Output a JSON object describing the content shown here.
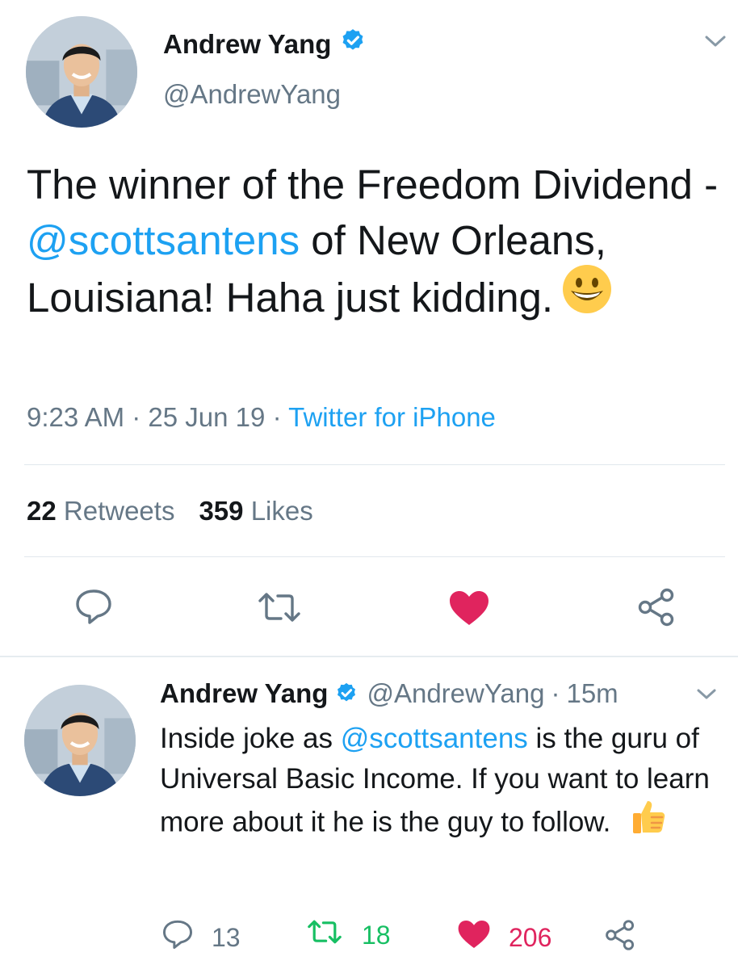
{
  "main_tweet": {
    "author_name": "Andrew Yang",
    "author_handle": "@AndrewYang",
    "text_before_mention": "The winner of the Freedom Dividend - ",
    "mention": "@scottsantens",
    "text_after_mention": " of New Orleans, Louisiana!  Haha just kidding.",
    "emoji": "grinning-face",
    "time": "9:23 AM",
    "date": "25 Jun 19",
    "source": "Twitter for iPhone",
    "retweet_count": "22",
    "retweet_label": "Retweets",
    "like_count": "359",
    "like_label": "Likes",
    "liked": true
  },
  "reply_tweet": {
    "author_name": "Andrew Yang",
    "author_handle": "@AndrewYang",
    "relative_time": "15m",
    "text_before_mention": "Inside joke as ",
    "mention": "@scottsantens",
    "text_after_mention": " is the guru of Universal Basic Income.  If you want to learn more about it he is the guy to follow.",
    "emoji": "thumbs-up",
    "reply_count": "13",
    "retweet_count": "18",
    "like_count": "206",
    "retweeted": true,
    "liked": true
  },
  "colors": {
    "accent_blue": "#1da1f2",
    "like_red": "#e0245e",
    "retweet_green": "#17bf63",
    "secondary_text": "#657786",
    "primary_text": "#14171a"
  },
  "icons": [
    "verified-badge-icon",
    "chevron-down-icon",
    "reply-icon",
    "retweet-icon",
    "heart-icon",
    "share-icon"
  ]
}
